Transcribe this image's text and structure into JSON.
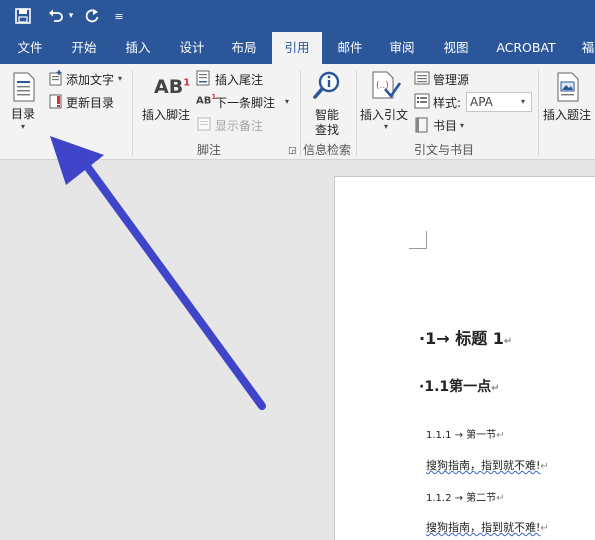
{
  "qat": {
    "save_icon": "save-icon",
    "undo_icon": "undo-icon",
    "redo_icon": "redo-icon",
    "customize_icon": "customize-icon",
    "customize_glyph": "≡",
    "dropdown_glyph": "▾"
  },
  "tabs": [
    {
      "label": "文件"
    },
    {
      "label": "开始"
    },
    {
      "label": "插入"
    },
    {
      "label": "设计"
    },
    {
      "label": "布局"
    },
    {
      "label": "引用",
      "active": true
    },
    {
      "label": "邮件"
    },
    {
      "label": "审阅"
    },
    {
      "label": "视图"
    },
    {
      "label": "ACROBAT"
    },
    {
      "label": "福"
    }
  ],
  "ribbon": {
    "toc": {
      "toc_label": "目录",
      "add_text_label": "添加文字",
      "update_toc_label": "更新目录"
    },
    "footnotes": {
      "insert_footnote_label": "插入脚注",
      "insert_endnote_label": "插入尾注",
      "next_footnote_label": "下一条脚注",
      "show_notes_label": "显示备注",
      "group_label": "脚注",
      "ab_text": "AB",
      "ab_sup": "1",
      "ab_small": "AB"
    },
    "research": {
      "smart_lookup_line1": "智能",
      "smart_lookup_line2": "查找",
      "group_label": "信息检索"
    },
    "citations": {
      "insert_citation_label": "插入引文",
      "manage_sources_label": "管理源",
      "style_label": "样式:",
      "style_value": "APA",
      "bibliography_label": "书目",
      "group_label": "引文与书目"
    },
    "captions": {
      "insert_caption_label": "插入题注"
    }
  },
  "document": {
    "heading1": "1→ 标题 1",
    "heading2": "1.1第一点",
    "heading3a": "1.1.1 → 第一节",
    "body1": "搜狗指南，指到就不难!",
    "heading3b": "1.1.2 → 第二节",
    "body2": "搜狗指南，指到就不难!",
    "bullet": "·",
    "para_mark": "↵"
  },
  "colors": {
    "ribbon_blue": "#2b579a",
    "arrow": "#3f44c8"
  }
}
